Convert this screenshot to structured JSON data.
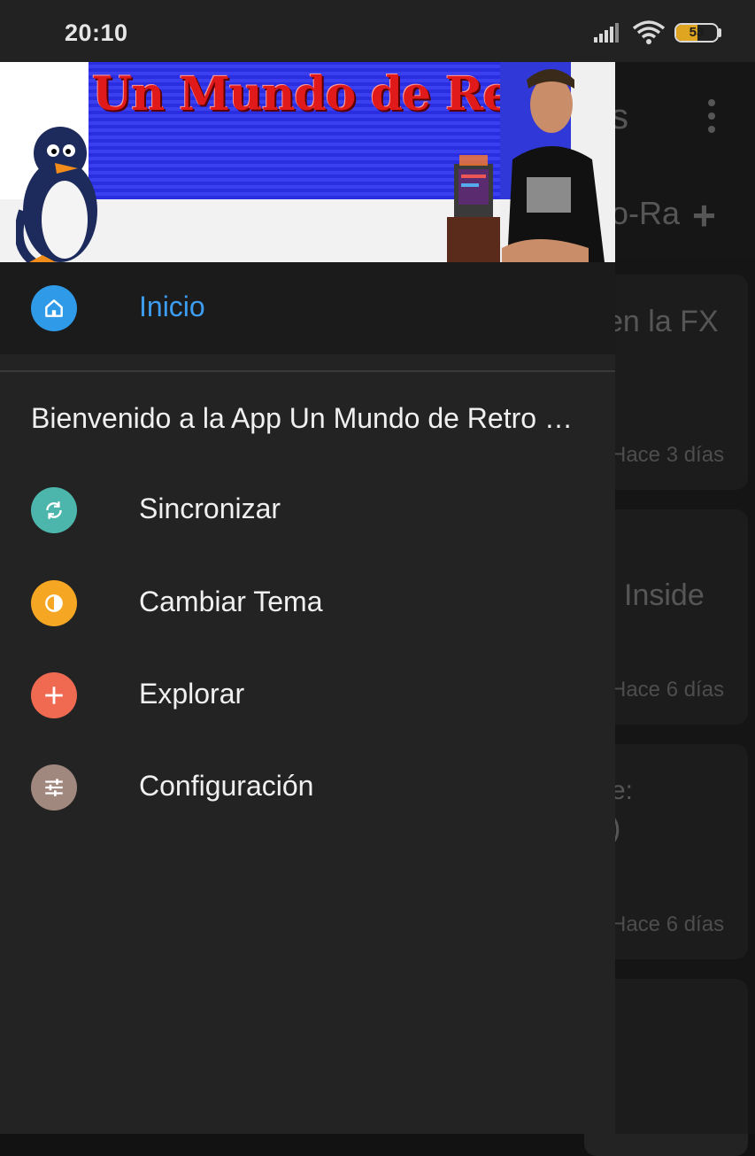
{
  "status_bar": {
    "time": "20:10",
    "battery": "53"
  },
  "background_app": {
    "title_fragment": "s",
    "tab_fragment": "o-Ra",
    "cards": [
      {
        "title": "en la FX",
        "time": "Hace 3 días"
      },
      {
        "title": "Inside",
        "time": "Hace 6 días"
      },
      {
        "title": "e:",
        "title2": ")",
        "time": "Hace 6 días"
      }
    ]
  },
  "drawer": {
    "header_image": {
      "banner_text": "Un Mundo de Retro Juegos"
    },
    "selected_item": {
      "label": "Inicio",
      "icon": "home-icon",
      "color": "#2f9be8"
    },
    "welcome_text": "Bienvenido a la App Un Mundo de Retro Juegos",
    "items": [
      {
        "label": "Sincronizar",
        "icon": "sync-icon",
        "color": "#4db6ac"
      },
      {
        "label": "Cambiar Tema",
        "icon": "theme-icon",
        "color": "#f5a623"
      },
      {
        "label": "Explorar",
        "icon": "add-icon",
        "color": "#ef6a50"
      },
      {
        "label": "Configuración",
        "icon": "tune-icon",
        "color": "#a1887f"
      }
    ]
  }
}
